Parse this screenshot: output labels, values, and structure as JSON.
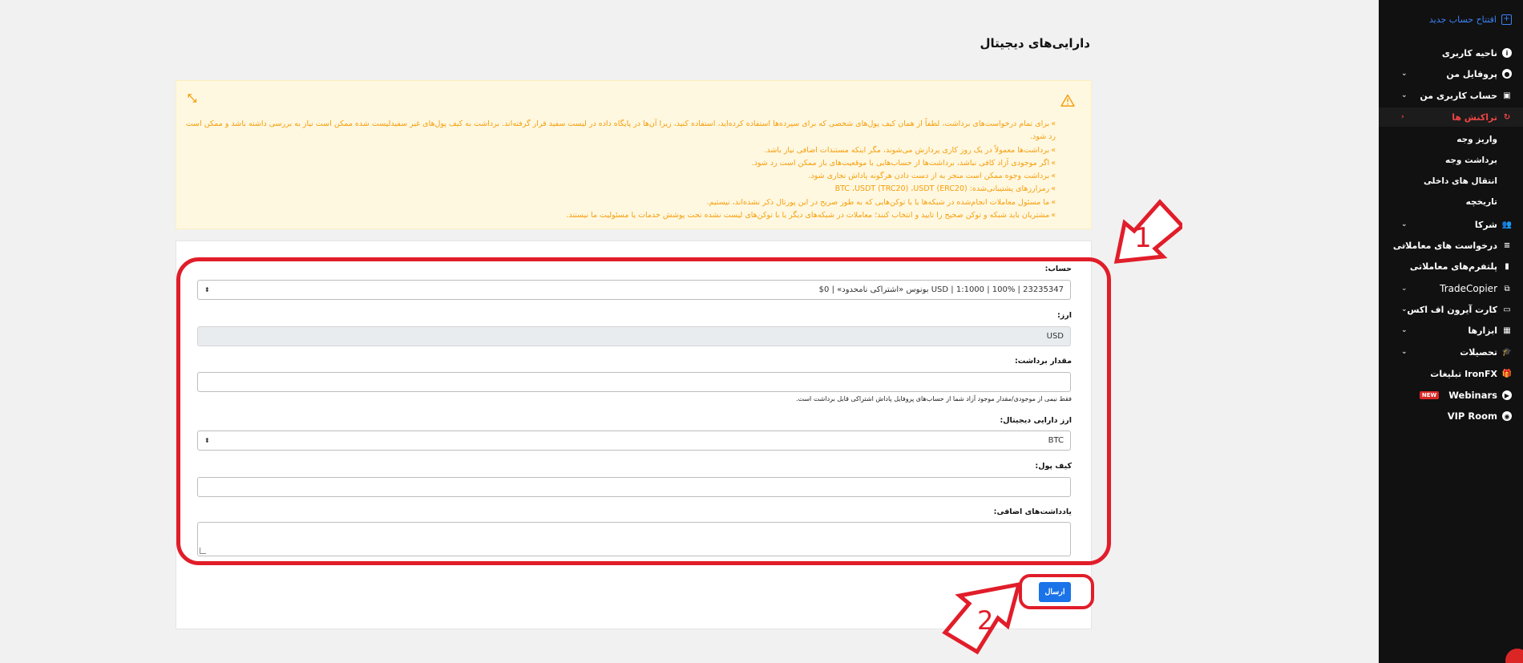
{
  "sidebar": {
    "open_account": "افتتاح حساب جدید",
    "items": [
      {
        "label": "ناحیه کاربری",
        "icon": "info-icon"
      },
      {
        "label": "پروفایل من",
        "icon": "user-icon"
      },
      {
        "label": "حساب کاربری من",
        "icon": "book-icon"
      },
      {
        "label": "تراکنش ها",
        "icon": "refresh-icon"
      },
      {
        "label": "شرکا",
        "icon": "users-icon"
      },
      {
        "label": "درخواست های معاملاتی",
        "icon": "list-icon"
      },
      {
        "label": "پلتفرم‌های معاملاتی",
        "icon": "bar-chart-icon"
      },
      {
        "label": "TradeCopier",
        "icon": "copy-icon"
      },
      {
        "label": "کارت آیرون اف اکس",
        "icon": "card-icon"
      },
      {
        "label": "ابزارها",
        "icon": "calculator-icon"
      },
      {
        "label": "تحصیلات",
        "icon": "graduation-icon"
      },
      {
        "label": "IronFX تبلیغات",
        "icon": "gift-icon"
      },
      {
        "label": "Webinars",
        "icon": "play-icon",
        "badge": "NEW"
      },
      {
        "label": "VIP Room",
        "icon": "vip-icon"
      }
    ],
    "sub_items": [
      "واریز وجه",
      "برداشت وجه",
      "انتقال های داخلی",
      "تاریخچه"
    ]
  },
  "page": {
    "title": "دارایی‌های دیجیتال"
  },
  "alert": {
    "lines": [
      "برای تمام درخواست‌های برداشت، لطفاً از همان کیف پول‌های شخصی که برای سپرده‌ها استفاده کرده‌اید، استفاده کنید، زیرا آن‌ها در پایگاه داده در لیست سفید قرار گرفته‌اند. برداشت به کیف پول‌های غیر سفیدلیست شده ممکن است نیاز به بررسی داشته باشد و ممکن است رد شود.",
      "برداشت‌ها معمولاً در یک روز کاری پردازش می‌شوند، مگر اینکه مستندات اضافی نیاز باشد.",
      "اگر موجودی آزاد کافی نباشد، برداشت‌ها از حساب‌هایی با موقعیت‌های باز ممکن است رد شود.",
      "برداشت وجوه ممکن است منجر به از دست دادن هرگونه پاداش تجاری شود.",
      "رمزارزهای پشتیبانی‌شده: BTC ،USDT (TRC20) ،USDT (ERC20)",
      "ما مسئول معاملات انجام‌شده در شبکه‌ها یا با توکن‌هایی که به طور صریح در این پورتال ذکر نشده‌اند، نیستیم.",
      "مشتریان باید شبکه و توکن صحیح را تایید و انتخاب کنند؛ معاملات در شبکه‌های دیگر یا با توکن‌های لیست نشده تحت پوشش خدمات یا مسئولیت ما نیستند."
    ]
  },
  "form": {
    "account_label": "حساب:",
    "account_value": "23235347 | 100% | 1:1000 | USD بونوس «اشتراکی نامحدود» | 0$",
    "currency_label": "ارز:",
    "currency_value": "USD",
    "amount_label": "مقدار برداشت:",
    "amount_value": "",
    "amount_help": "فقط نیمی از موجودی/مقدار موجود آزاد شما از حساب‌های پروفایل پاداش اشتراکی قابل برداشت است.",
    "crypto_label": "ارز دارایی دیجیتال:",
    "crypto_value": "BTC",
    "wallet_label": "کیف پول:",
    "wallet_value": "",
    "notes_label": "یادداشت‌های اضافی:",
    "notes_value": "",
    "submit_label": "ارسال"
  },
  "annotations": {
    "step1": "1",
    "step2": "2"
  },
  "colors": {
    "accent_blue": "#1a73e8",
    "annotation_red": "#e11d2a",
    "alert_text": "#f59e0b",
    "sidebar_bg": "#111111"
  }
}
